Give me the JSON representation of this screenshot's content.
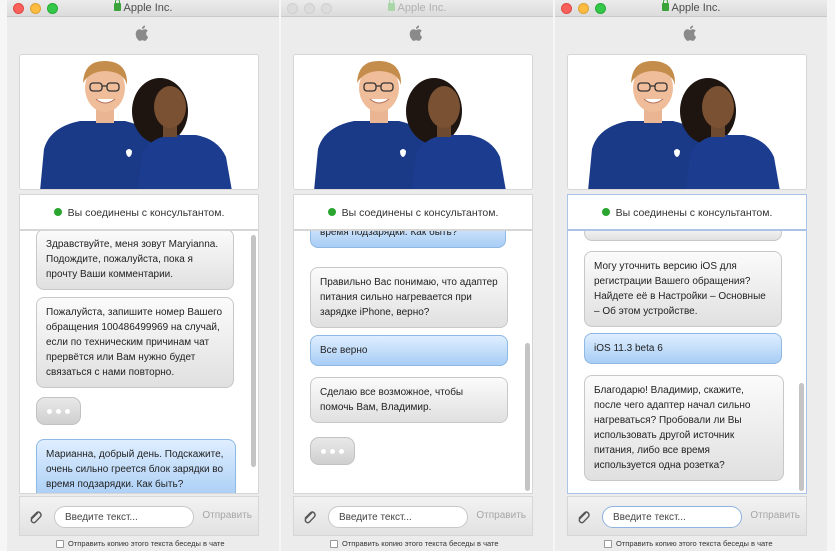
{
  "window_title": "Apple Inc.",
  "status_text": "Вы соединены с консультантом.",
  "input_placeholder": "Введите текст...",
  "send_label": "Отправить",
  "copy_label": "Отправить копию этого текста беседы в чате",
  "colors": {
    "online": "#2aa530",
    "agent_bubble": "#e6e6e6",
    "user_bubble": "#a8cdf5"
  },
  "icons": [
    "lock-icon",
    "apple-logo-icon",
    "online-dot-icon",
    "paperclip-icon"
  ],
  "windows": [
    {
      "messages": [
        {
          "text": "Здравствуйте, меня зовут Maryianna. Подождите, пожалуйста, пока я прочту Ваши комментарии."
        },
        {
          "text": "Пожалуйста, запишите номер Вашего обращения 100486499969 на случай, если по техническим причинам чат прервётся или Вам нужно будет связаться с нами повторно."
        },
        {
          "text": "Марианна, добрый день. Подскажите, очень сильно греется блок зарядки во время подзарядки. Как быть?"
        }
      ]
    },
    {
      "messages": [
        {
          "text": "время подзарядки. Как быть?"
        },
        {
          "text": "Правильно Вас понимаю, что адаптер питания сильно нагревается при зарядке iPhone, верно?"
        },
        {
          "text": "Все верно"
        },
        {
          "text": "Сделаю все возможное, чтобы помочь Вам, Владимир."
        }
      ]
    },
    {
      "messages": [
        {
          "text": "Могу уточнить версию iOS для регистрации Вашего обращения? Найдете её в Настройки – Основные – Об этом устройстве."
        },
        {
          "text": "iOS 11.3 beta 6"
        },
        {
          "text": "Благодарю! Владимир, скажите, после чего адаптер начал сильно нагреваться? Пробовали ли Вы использовать другой источник питания, либо все время используется одна розетка?"
        }
      ]
    }
  ]
}
